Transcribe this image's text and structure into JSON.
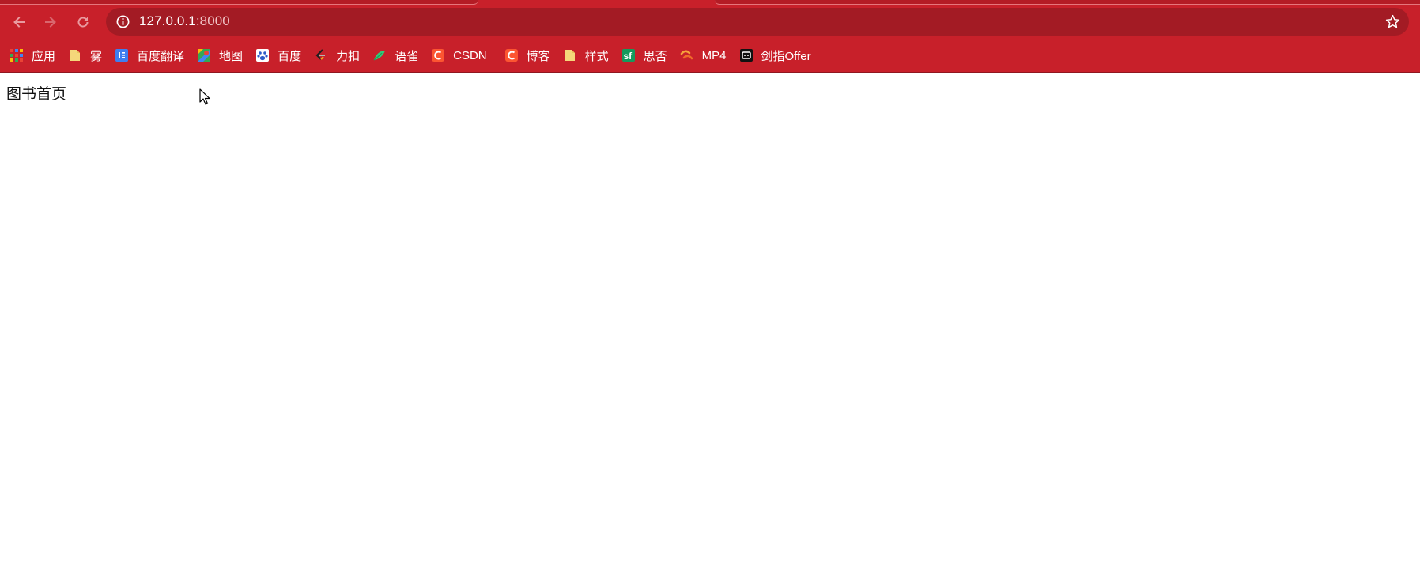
{
  "browser": {
    "url_host": "127.0.0.1",
    "url_port": ":8000",
    "nav_icons": [
      "back-arrow",
      "forward-arrow",
      "reload"
    ],
    "accent_color": "#c8202a"
  },
  "bookmarks": [
    {
      "label": "应用",
      "icon": "apps-grid-icon"
    },
    {
      "label": "雾",
      "icon": "folder-icon"
    },
    {
      "label": "百度翻译",
      "icon": "translate-icon"
    },
    {
      "label": "地图",
      "icon": "maps-icon"
    },
    {
      "label": "百度",
      "icon": "baidu-paw-icon"
    },
    {
      "label": "力扣",
      "icon": "leetcode-icon"
    },
    {
      "label": "语雀",
      "icon": "yuque-icon"
    },
    {
      "label": "CSDN",
      "icon": "csdn-icon"
    },
    {
      "label": "博客",
      "icon": "csdn-icon"
    },
    {
      "label": "样式",
      "icon": "folder-icon"
    },
    {
      "label": "思否",
      "icon": "segmentfault-icon"
    },
    {
      "label": "MP4",
      "icon": "mp4-icon"
    },
    {
      "label": "剑指Offer",
      "icon": "nowcoder-icon"
    }
  ],
  "page": {
    "heading": "图书首页"
  }
}
